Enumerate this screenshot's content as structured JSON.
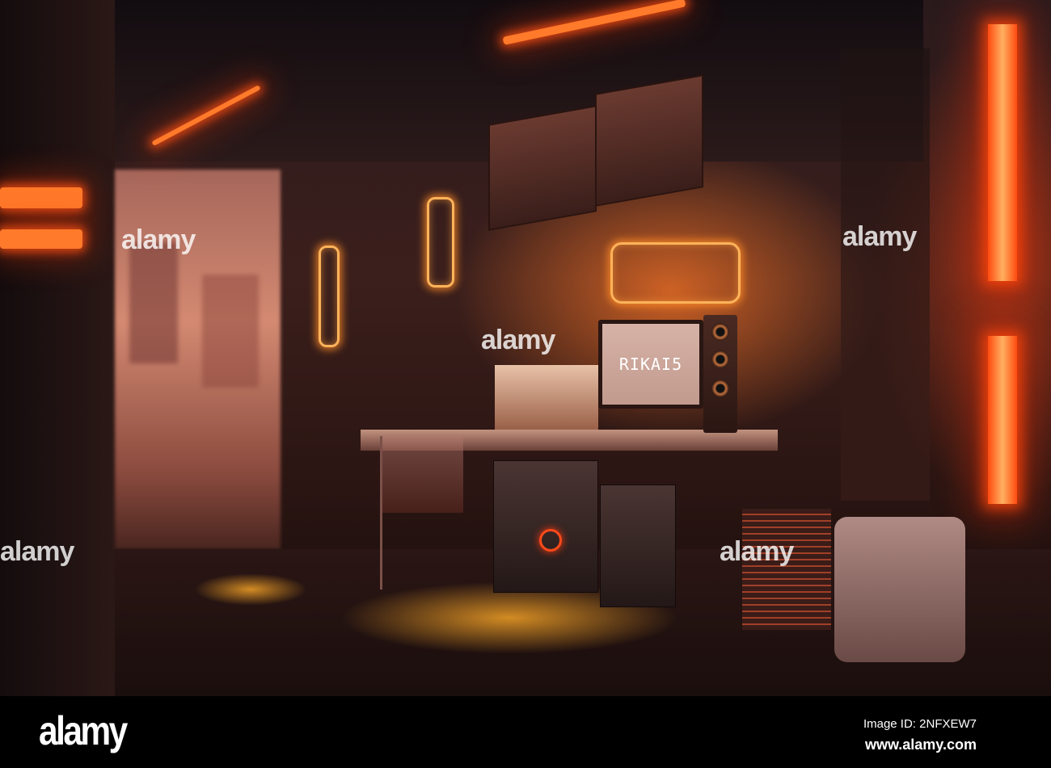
{
  "image": {
    "description_label": "Cyberpunk room with neon lights and computer desk",
    "monitor_text": "RIKAI5",
    "watermark_text": "alamy"
  },
  "footer": {
    "logo": "alamy",
    "image_id": "Image ID: 2NFXEW7",
    "website": "www.alamy.com"
  },
  "colors": {
    "neon": "#ff7a2a",
    "footer_bg": "#000000"
  }
}
